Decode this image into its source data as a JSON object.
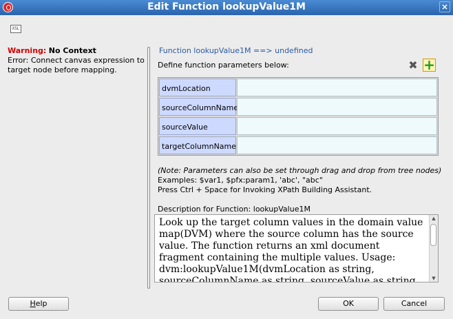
{
  "window": {
    "title": "Edit Function lookupValue1M",
    "close_glyph": "×"
  },
  "toolbar": {
    "xpath_icon_label": "XSL"
  },
  "warning": {
    "label": "Warning:",
    "title": "No Context",
    "message": "Error: Connect canvas expression to target node before mapping."
  },
  "editor": {
    "function_header": "Function lookupValue1M ==> undefined",
    "define_label": "Define function parameters below:",
    "delete_glyph": "✖",
    "add_glyph": "+",
    "parameters": [
      {
        "name": "dvmLocation",
        "value": ""
      },
      {
        "name": "sourceColumnName",
        "value": ""
      },
      {
        "name": "sourceValue",
        "value": ""
      },
      {
        "name": "targetColumnName",
        "value": ""
      }
    ],
    "note": "(Note: Parameters can also be set through drag and drop from tree nodes)",
    "examples": "Examples: $var1, $pfx:param1, 'abc', \"abc\"",
    "hint": "Press Ctrl + Space for Invoking XPath Building Assistant.",
    "description_label": "Description for Function: lookupValue1M",
    "description": "Look up the target column values in the domain value map(DVM) where the source column has the source value. The function returns an xml document fragment containing the multiple values. Usage: dvm:lookupValue1M(dvmLocation as string, sourceColumnName as string, sourceValue as string"
  },
  "buttons": {
    "help_mnemonic": "H",
    "help_rest": "elp",
    "ok": "OK",
    "cancel": "Cancel"
  },
  "colors": {
    "title_bar": "#2a64ad",
    "warning": "#d10000",
    "header_link": "#2c5aa0",
    "param_name_bg": "#cdd9ff",
    "param_value_bg": "#eefafc"
  }
}
